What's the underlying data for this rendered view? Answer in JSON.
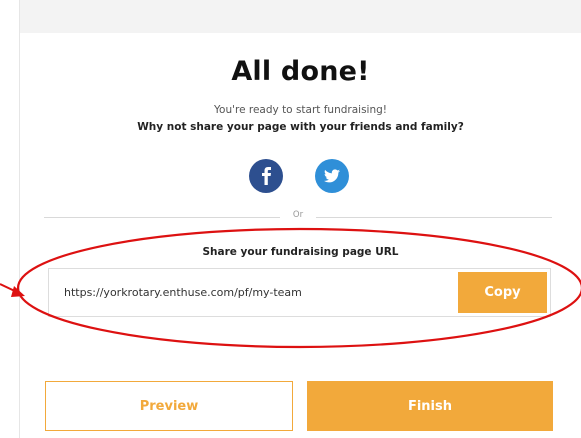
{
  "header": {
    "title": "All done!",
    "subtitle": "You're ready to start fundraising!",
    "prompt": "Why not share your page with your friends and family?"
  },
  "social": {
    "facebook_icon": "facebook-icon",
    "twitter_icon": "twitter-icon",
    "facebook_color": "#2d4f8f",
    "twitter_color": "#2f8fd8"
  },
  "divider": {
    "or_text": "Or"
  },
  "share": {
    "label": "Share your fundraising page URL",
    "url": "https://yorkrotary.enthuse.com/pf/my-team",
    "copy_label": "Copy"
  },
  "actions": {
    "preview_label": "Preview",
    "finish_label": "Finish"
  },
  "colors": {
    "accent": "#f2a93b",
    "annotation": "#dd1111"
  }
}
